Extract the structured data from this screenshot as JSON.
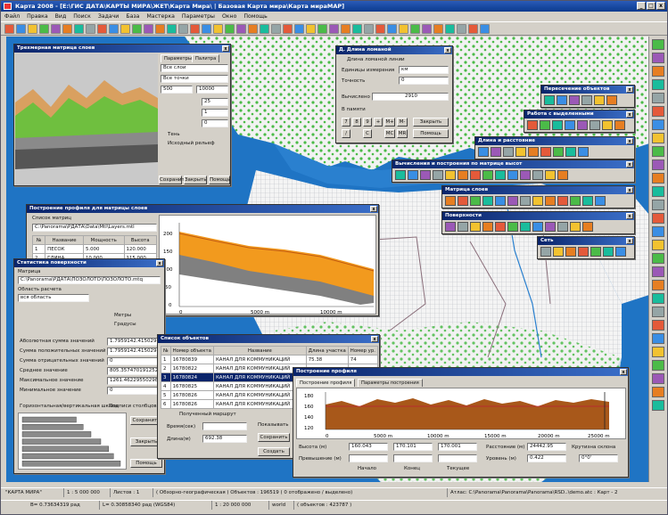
{
  "app": {
    "title": "Карта 2008 - [E:\\ГИС ДАТА\\КАРТЫ МИРА\\ЖЕТ\\Карта Мира\\ | Базовая Карта мира\\Карта мираМАР]",
    "minimize": "_",
    "maximize": "□",
    "close": "x"
  },
  "menu": [
    "Файл",
    "Правка",
    "Вид",
    "Поиск",
    "Задачи",
    "База",
    "Мастерка",
    "Параметры",
    "Окно",
    "Помощь"
  ],
  "colors": {
    "ocean": "#1f74c4",
    "land": "#f2f2f2",
    "vegetation": "#4bbb48",
    "titlebar": "#0a246a",
    "profile_orange": "#f29a1e",
    "profile_brown": "#a8581a"
  },
  "surface_window": {
    "title": "Трехмерная матрица слоев",
    "tabs": [
      "Параметры",
      "Палитра"
    ],
    "fields": [
      "Все слои",
      "Все точки",
      "500",
      "10000",
      "25",
      "1",
      "0"
    ],
    "options": [
      "Тень",
      "Исходный рельеф"
    ],
    "buttons": [
      "Сохранить",
      "Закрыть",
      "Помощь"
    ]
  },
  "length_window": {
    "title": "Д. Длина ломаной",
    "group": "Длина ломаной линии",
    "units_label": "Единицы измерения",
    "units_value": "км",
    "accuracy_label": "Точность",
    "accuracy_value": "0",
    "computed_label": "Вычислено",
    "computed_value": "2910",
    "memory_label": "В памяти",
    "keys_row1": [
      "7",
      "8",
      "9",
      "+",
      "M+",
      "M-"
    ],
    "keys_row2": [
      "/",
      "C",
      "MC",
      "MR"
    ],
    "close_button": "Закрыть",
    "help_button": "Помощь"
  },
  "toolbars": [
    {
      "title": "Пересечение объектов",
      "icons": 6
    },
    {
      "title": "Работа с выделенными",
      "icons": 8
    },
    {
      "title": "Длина и расстояние",
      "icons": 9
    },
    {
      "title": "Вычисления и построения по матрице высот",
      "icons": 14
    },
    {
      "title": "Матрица слоев",
      "icons": 13
    },
    {
      "title": "Поверхности",
      "icons": 12
    },
    {
      "title": "Сеть",
      "icons": 7
    }
  ],
  "matrix_profile_window": {
    "title": "Построение профиля для матрицы слоев",
    "list_label": "Список матриц",
    "matrix_path": "C:\\Panorama\\РДАТА\\Data\\Mtl\\Layers.mtl",
    "columns": [
      "№",
      "Название",
      "Мощность",
      "Высота"
    ],
    "rows": [
      [
        "1",
        "ПЕСОК",
        "5.000",
        "120.000"
      ],
      [
        "2",
        "ГЛИНА",
        "10.000",
        "115.000"
      ]
    ],
    "chart": {
      "y_ticks": [
        "200",
        "150",
        "100",
        "50",
        "0"
      ],
      "x_ticks": [
        "0",
        "5000 m",
        "10000 m"
      ]
    }
  },
  "stats_window": {
    "title": "Статистика поверхности",
    "path_label": "Матрица",
    "path": "C:\\Panorama\\РДАТА\\ПОЗОЛОТО\\ПОЗОЛОТО.mtq",
    "area_label": "Область расчета",
    "area_value": "вся область",
    "radio_options": [
      "Метры",
      "Градусы"
    ],
    "stat_labels": [
      "Абсолютная сумма значений",
      "Сумма положительных значений",
      "Сумма отрицательных значений",
      "Среднее значение",
      "Максимальное значение",
      "Минимальное значение"
    ],
    "stat_values": [
      "1.7959142.4150296",
      "1.7959142.4150296",
      "0",
      "805.357470191252",
      "1261.46229550298",
      "0"
    ],
    "checkbox_horizontal": "Горизонтальная/вертикальная шкала",
    "checkbox_signatures": "Подписи столбцов",
    "bars": [
      0.55,
      0.62,
      0.7,
      0.8,
      0.88,
      0.93,
      1.0
    ],
    "buttons": [
      "Сохранить",
      "Закрыть",
      "Помощь"
    ]
  },
  "objects_window": {
    "title": "Список объектов",
    "columns": [
      "№",
      "Номер объекта",
      "Название",
      "Длина участка",
      "Номер ур."
    ],
    "rows": [
      [
        "1",
        "16780839",
        "КАНАЛ ДЛЯ КОММУНИКАЦИЙ",
        "75.38",
        "74"
      ],
      [
        "2",
        "16780822",
        "КАНАЛ ДЛЯ КОММУНИКАЦИЙ",
        "",
        ""
      ],
      [
        "3",
        "16780824",
        "КАНАЛ ДЛЯ КОММУНИКАЦИЙ",
        "",
        ""
      ],
      [
        "4",
        "16780825",
        "КАНАЛ ДЛЯ КОММУНИКАЦИЙ",
        "",
        ""
      ],
      [
        "5",
        "16780826",
        "КАНАЛ ДЛЯ КОММУНИКАЦИЙ",
        "",
        ""
      ],
      [
        "6",
        "16780826",
        "КАНАЛ ДЛЯ КОММУНИКАЦИЙ",
        "",
        ""
      ]
    ],
    "selected_row": 2,
    "route_label": "Полученный маршрут",
    "time_label": "Время(сек)",
    "length_label": "Длина(м)",
    "length_value": "692.38",
    "show_label": "Показывать",
    "save_button": "Сохранить",
    "create_button": "Создать"
  },
  "profile_window": {
    "title": "Построение профиля",
    "tabs": [
      "Построение профиля",
      "Параметры построения"
    ],
    "chart": {
      "y_ticks": [
        "180",
        "160",
        "140",
        "120"
      ],
      "x_ticks": [
        "0",
        "5000 m",
        "10000 m",
        "15000 m",
        "20000 m",
        "25000 m"
      ]
    },
    "height_label": "Высота (м)",
    "excess_label": "Превышение (м)",
    "heights": [
      "160.043",
      "170.101",
      "170.001"
    ],
    "point_labels": [
      "Начало",
      "Конец",
      "Текущее"
    ],
    "distance_label": "Расстояние (м)",
    "distance_value": "24442.95",
    "level_label": "Уровень (м)",
    "level_value": "0.422",
    "slope_label": "Крутизна склона",
    "slope_value": "0°0'"
  },
  "status": {
    "line1": [
      "\"КАРТА МИРА\"",
      "1 : 5 000 000",
      "Листов : 1",
      "( Обзорно-географическая ) Объектов : 196519 ( 0 отображено / выделено)",
      "Атлас: C:\\Panorama\\Panorama\\Panorama\\RSD..\\demo.atс : Карт - 2"
    ],
    "line2": [
      "B= 0.73634319 рад",
      "L= 0.30858340 рад (WGS84)",
      "1 : 20 000 000",
      "world",
      "( объектов : 423787 )"
    ]
  }
}
